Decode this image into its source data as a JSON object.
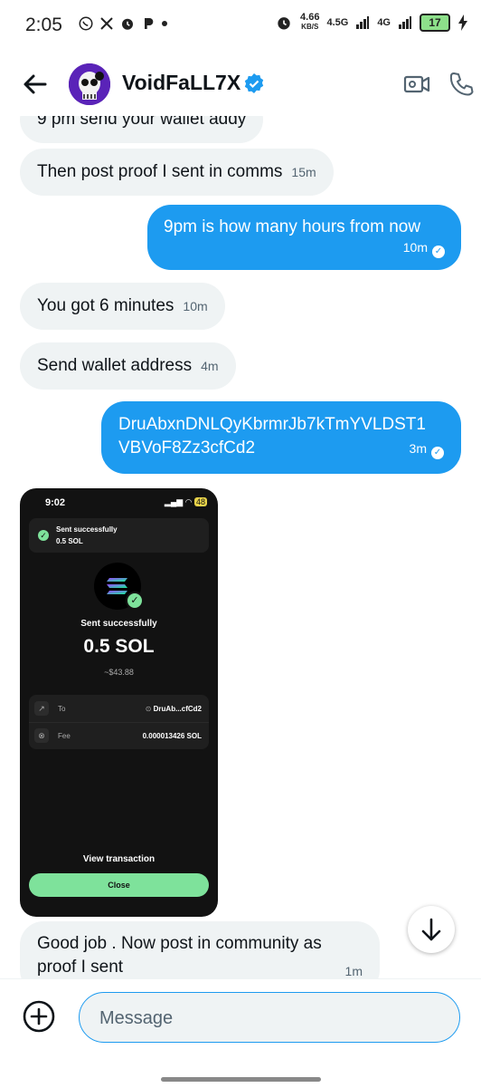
{
  "statusbar": {
    "time": "2:05",
    "left_icons": [
      "whatsapp-icon",
      "x-icon",
      "alarm-icon",
      "p-icon"
    ],
    "speed_value": "4.66",
    "speed_unit": "KB/S",
    "network1": "4.5G",
    "network2": "4G",
    "battery": "17"
  },
  "header": {
    "title": "VoidFaLL7X",
    "verified": true
  },
  "messages": {
    "m0_text": "9 pm send your wallet addy",
    "m1_text": "Then post proof I sent in comms",
    "m1_time": "15m",
    "m2_text": "9pm is how many hours from now",
    "m2_time": "10m",
    "m3_text": "You got 6 minutes",
    "m3_time": "10m",
    "m4_text": "Send wallet address",
    "m4_time": "4m",
    "m5_line1": "DruAbxnDNLQyKbrmrJb7kTmYVLDST1",
    "m5_line2": "VBVoF8Zz3cfCd2",
    "m5_time": "3m",
    "m7_line1": "Good job . Now post in community as",
    "m7_line2": "proof I sent",
    "m7_time": "1m"
  },
  "screenshot_image": {
    "time": "9:02",
    "status_right": "48",
    "card_title": "Sent successfully",
    "card_amount": "0.5 SOL",
    "sent_label": "Sent successfully",
    "amount": "0.5 SOL",
    "usd": "~$43.88",
    "to_label": "To",
    "to_value": "DruAb...cfCd2",
    "fee_label": "Fee",
    "fee_value": "0.000013426 SOL",
    "view_tx": "View transaction",
    "close_label": "Close",
    "accent": "#7ee29b"
  },
  "composer": {
    "placeholder": "Message"
  },
  "colors": {
    "accent": "#1d9bf0",
    "incoming_bubble": "#eff3f4"
  }
}
